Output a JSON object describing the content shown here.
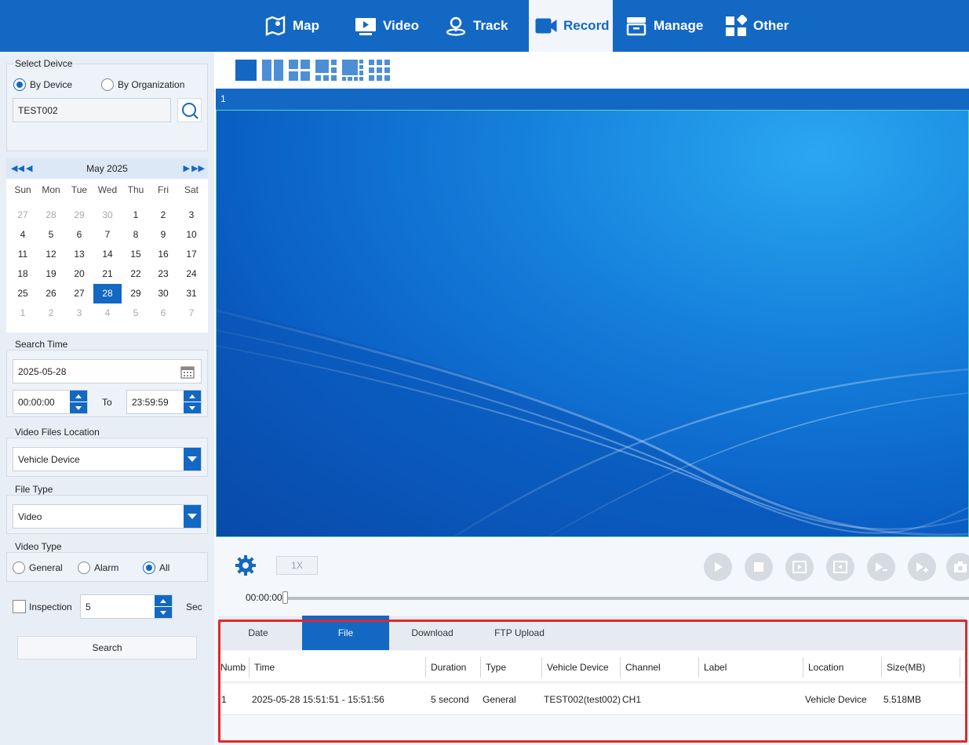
{
  "nav": {
    "items": [
      {
        "label": "Map",
        "icon": "map-icon"
      },
      {
        "label": "Video",
        "icon": "video-icon"
      },
      {
        "label": "Track",
        "icon": "track-icon"
      },
      {
        "label": "Record",
        "icon": "record-icon",
        "active": true
      },
      {
        "label": "Manage",
        "icon": "manage-icon"
      },
      {
        "label": "Other",
        "icon": "other-icon"
      }
    ]
  },
  "select_device": {
    "title": "Select Deivce",
    "by_device": "By Device",
    "by_organization": "By Organization",
    "selected_mode": "By Device",
    "device_value": "TEST002"
  },
  "calendar": {
    "month_label": "May 2025",
    "weekdays": [
      "Sun",
      "Mon",
      "Tue",
      "Wed",
      "Thu",
      "Fri",
      "Sat"
    ],
    "weeks": [
      [
        "27",
        "28",
        "29",
        "30",
        "1",
        "2",
        "3"
      ],
      [
        "4",
        "5",
        "6",
        "7",
        "8",
        "9",
        "10"
      ],
      [
        "11",
        "12",
        "13",
        "14",
        "15",
        "16",
        "17"
      ],
      [
        "18",
        "19",
        "20",
        "21",
        "22",
        "23",
        "24"
      ],
      [
        "25",
        "26",
        "27",
        "28",
        "29",
        "30",
        "31"
      ],
      [
        "1",
        "2",
        "3",
        "4",
        "5",
        "6",
        "7"
      ]
    ],
    "selected_day": "28"
  },
  "search_time": {
    "title": "Search Time",
    "date": "2025-05-28",
    "start": "00:00:00",
    "to_label": "To",
    "end": "23:59:59"
  },
  "video_files_location": {
    "title": "Video Files Location",
    "value": "Vehicle Device"
  },
  "file_type": {
    "title": "File Type",
    "value": "Video"
  },
  "video_type": {
    "title": "Video Type",
    "options": [
      "General",
      "Alarm",
      "All"
    ],
    "selected": "All"
  },
  "inspection": {
    "label": "Inspection",
    "checked": false,
    "value": "5",
    "unit": "Sec"
  },
  "search_button": "Search",
  "player": {
    "window_index": "1",
    "speed": "1X",
    "time": "00:00:00",
    "progress": 0
  },
  "file_tabs": [
    "Date",
    "File",
    "Download",
    "FTP Upload"
  ],
  "active_tab": "File",
  "table": {
    "headers": [
      "Numbe",
      "Time",
      "Duration",
      "Type",
      "Vehicle Device",
      "Channel",
      "Label",
      "Location",
      "Size(MB)",
      "I"
    ],
    "rows": [
      [
        "1",
        "2025-05-28 15:51:51 - 15:51:56",
        "5 second",
        "General",
        "TEST002(test002)",
        "CH1",
        "",
        "Vehicle Device",
        "5.518MB",
        ""
      ]
    ]
  },
  "colors": {
    "brand": "#1368c4",
    "highlight_border": "#e3272a"
  }
}
